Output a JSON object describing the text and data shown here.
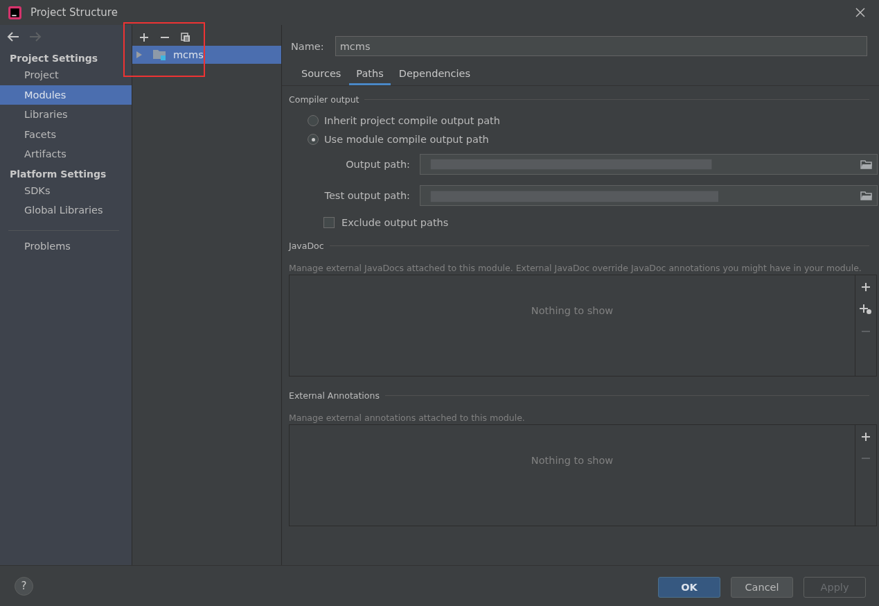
{
  "window": {
    "title": "Project Structure"
  },
  "nav": {
    "back_disabled": false,
    "forward_disabled": true
  },
  "sidebar": {
    "sections": [
      {
        "heading": "Project Settings",
        "items": [
          {
            "label": "Project",
            "selected": false
          },
          {
            "label": "Modules",
            "selected": true
          },
          {
            "label": "Libraries",
            "selected": false
          },
          {
            "label": "Facets",
            "selected": false
          },
          {
            "label": "Artifacts",
            "selected": false
          }
        ]
      },
      {
        "heading": "Platform Settings",
        "items": [
          {
            "label": "SDKs",
            "selected": false
          },
          {
            "label": "Global Libraries",
            "selected": false
          }
        ]
      }
    ],
    "footer_items": [
      {
        "label": "Problems",
        "selected": false
      }
    ]
  },
  "module_tree": {
    "highlighted": true,
    "items": [
      {
        "label": "mcms",
        "selected": true,
        "expanded": false
      }
    ]
  },
  "name_field": {
    "label": "Name:",
    "value": "mcms"
  },
  "tabs": [
    {
      "label": "Sources",
      "selected": false
    },
    {
      "label": "Paths",
      "selected": true
    },
    {
      "label": "Dependencies",
      "selected": false
    }
  ],
  "compiler_output": {
    "title": "Compiler output",
    "options": [
      {
        "label": "Inherit project compile output path",
        "selected": false
      },
      {
        "label": "Use module compile output path",
        "selected": true
      }
    ],
    "paths": [
      {
        "label": "Output path:",
        "redacted": true
      },
      {
        "label": "Test output path:",
        "redacted": true
      }
    ],
    "exclude": {
      "label": "Exclude output paths",
      "checked": false
    }
  },
  "javadoc": {
    "title": "JavaDoc",
    "description": "Manage external JavaDocs attached to this module. External JavaDoc override JavaDoc annotations you might have in your module.",
    "empty_text": "Nothing to show",
    "actions": [
      {
        "kind": "add",
        "disabled": false
      },
      {
        "kind": "add-url",
        "disabled": false
      },
      {
        "kind": "remove",
        "disabled": true
      }
    ]
  },
  "annotations": {
    "title": "External Annotations",
    "description": "Manage external annotations attached to this module.",
    "empty_text": "Nothing to show",
    "actions": [
      {
        "kind": "add",
        "disabled": false
      },
      {
        "kind": "remove",
        "disabled": true
      }
    ]
  },
  "buttons": [
    {
      "label": "OK",
      "kind": "primary",
      "disabled": false
    },
    {
      "label": "Cancel",
      "kind": "normal",
      "disabled": false
    },
    {
      "label": "Apply",
      "kind": "normal",
      "disabled": true
    }
  ],
  "help": "?"
}
